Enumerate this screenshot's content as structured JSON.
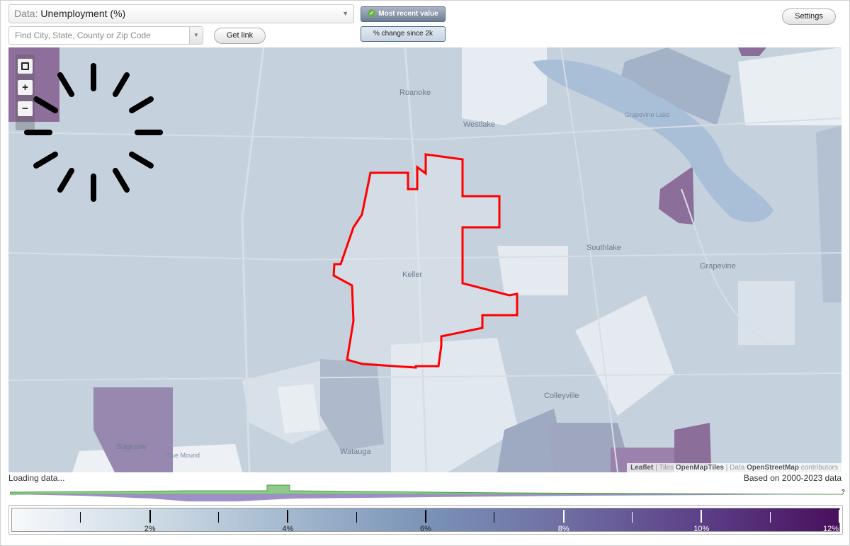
{
  "header": {
    "data_prefix": "Data:",
    "data_value": "Unemployment (%)",
    "search_placeholder": "Find City, State, County or Zip Code",
    "get_link_label": "Get link",
    "most_recent_label": "Most recent value",
    "change_label": "% change since 2k",
    "settings_label": "Settings"
  },
  "map": {
    "places": {
      "roanoke": "Roanoke",
      "westlake": "Westlake",
      "grapevine_lake": "Grapevine Lake",
      "southlake": "Southlake",
      "grapevine": "Grapevine",
      "keller": "Keller",
      "colleyville": "Colleyville",
      "saginaw": "Saginaw",
      "blue_mound": "Blue Mound",
      "watauga": "Watauga"
    },
    "attribution": {
      "leaflet": "Leaflet",
      "tiles_prefix": "| Tiles",
      "tiles": "OpenMapTiles",
      "data_prefix": "| Data",
      "data": "OpenStreetMap",
      "suffix": "contributors"
    },
    "zoom": {
      "zoom_in": "+",
      "zoom_out": "−"
    },
    "colors": {
      "highlight_outline": "#ff0000",
      "lake": "#a9bfd8",
      "high_unemployment": "#8c6e9a"
    }
  },
  "footer": {
    "status": "Loading data...",
    "based_on": "Based on 2000-2023 data",
    "help": "?"
  },
  "legend": {
    "labels": [
      "2%",
      "4%",
      "6%",
      "8%",
      "10%",
      "12%"
    ],
    "min": 0,
    "max": 12,
    "color_stops": [
      "#f7f9fb",
      "#cfdbe6",
      "#a3b9cf",
      "#7a93b7",
      "#6f6ea3",
      "#5c3f88",
      "#480f5c"
    ]
  }
}
